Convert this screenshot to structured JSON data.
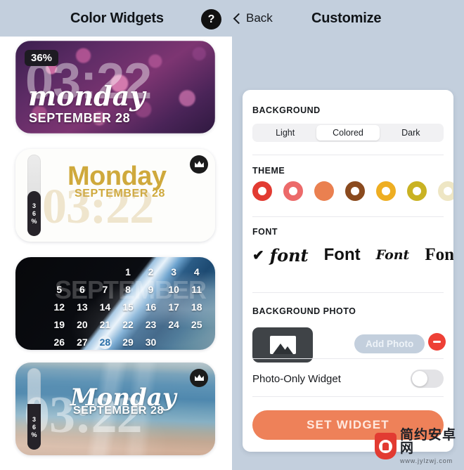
{
  "header": {
    "app_title": "Color Widgets",
    "help_icon_label": "?",
    "back_label": "Back",
    "screen_title": "Customize"
  },
  "previews": [
    {
      "id": "widget-floral",
      "style": "floral-purple",
      "battery_badge": "36%",
      "clock": "03:22",
      "day": "monday",
      "date": "SEPTEMBER 28",
      "has_crown": false
    },
    {
      "id": "widget-white-gold",
      "style": "white-gold",
      "battery_value": "36%",
      "battery_digits": [
        "3",
        "6",
        "%"
      ],
      "clock": "03:22",
      "day": "Monday",
      "date": "SEPTEMBER 28",
      "has_crown": true
    },
    {
      "id": "widget-calendar-earth",
      "style": "calendar-earth",
      "month_watermark": "SEPTEMBER",
      "days": [
        "",
        "",
        "",
        "1",
        "2",
        "3",
        "4",
        "5",
        "6",
        "7",
        "8",
        "9",
        "10",
        "11",
        "12",
        "13",
        "14",
        "15",
        "16",
        "17",
        "18",
        "19",
        "20",
        "21",
        "22",
        "23",
        "24",
        "25",
        "26",
        "27",
        "28",
        "29",
        "30"
      ],
      "today": "28",
      "has_crown": false
    },
    {
      "id": "widget-beach",
      "style": "beach",
      "battery_value": "36%",
      "battery_digits": [
        "3",
        "6",
        "%"
      ],
      "clock": "03:22",
      "day": "Monday",
      "date": "SEPTEMBER 28",
      "has_crown": true
    }
  ],
  "panel": {
    "background": {
      "label": "BACKGROUND",
      "options": [
        "Light",
        "Colored",
        "Dark"
      ],
      "selected": "Colored"
    },
    "theme": {
      "label": "THEME",
      "swatches": [
        {
          "color": "#e23b32",
          "type": "ring",
          "selected": true
        },
        {
          "color": "#ec6a6a",
          "type": "ring",
          "selected": false
        },
        {
          "color": "#ea8050",
          "type": "solid",
          "selected": false
        },
        {
          "color": "#8a4a1e",
          "type": "ring",
          "selected": false
        },
        {
          "color": "#eeae22",
          "type": "ring",
          "selected": false
        },
        {
          "color": "#c9b223",
          "type": "ring",
          "selected": false
        },
        {
          "color": "#eee6c4",
          "type": "ring",
          "selected": false
        }
      ]
    },
    "font": {
      "label": "FONT",
      "check_glyph": "✔",
      "options": [
        {
          "sample": "font",
          "style": "script",
          "selected": true
        },
        {
          "sample": "Font",
          "style": "bold-sans",
          "selected": false
        },
        {
          "sample": "Font",
          "style": "brush",
          "selected": false
        },
        {
          "sample": "Fon",
          "style": "serif",
          "selected": false
        }
      ]
    },
    "background_photo": {
      "label": "BACKGROUND PHOTO",
      "thumb_icon": "image-icon",
      "add_button": "Add Photo",
      "remove_button": "remove-icon"
    },
    "photo_only": {
      "label": "Photo-Only Widget",
      "enabled": false
    },
    "cta": {
      "label": "SET WIDGET",
      "color": "#ee8159"
    }
  },
  "watermark": {
    "site_name": "简约安卓网",
    "url": "www.jylzwj.com"
  }
}
